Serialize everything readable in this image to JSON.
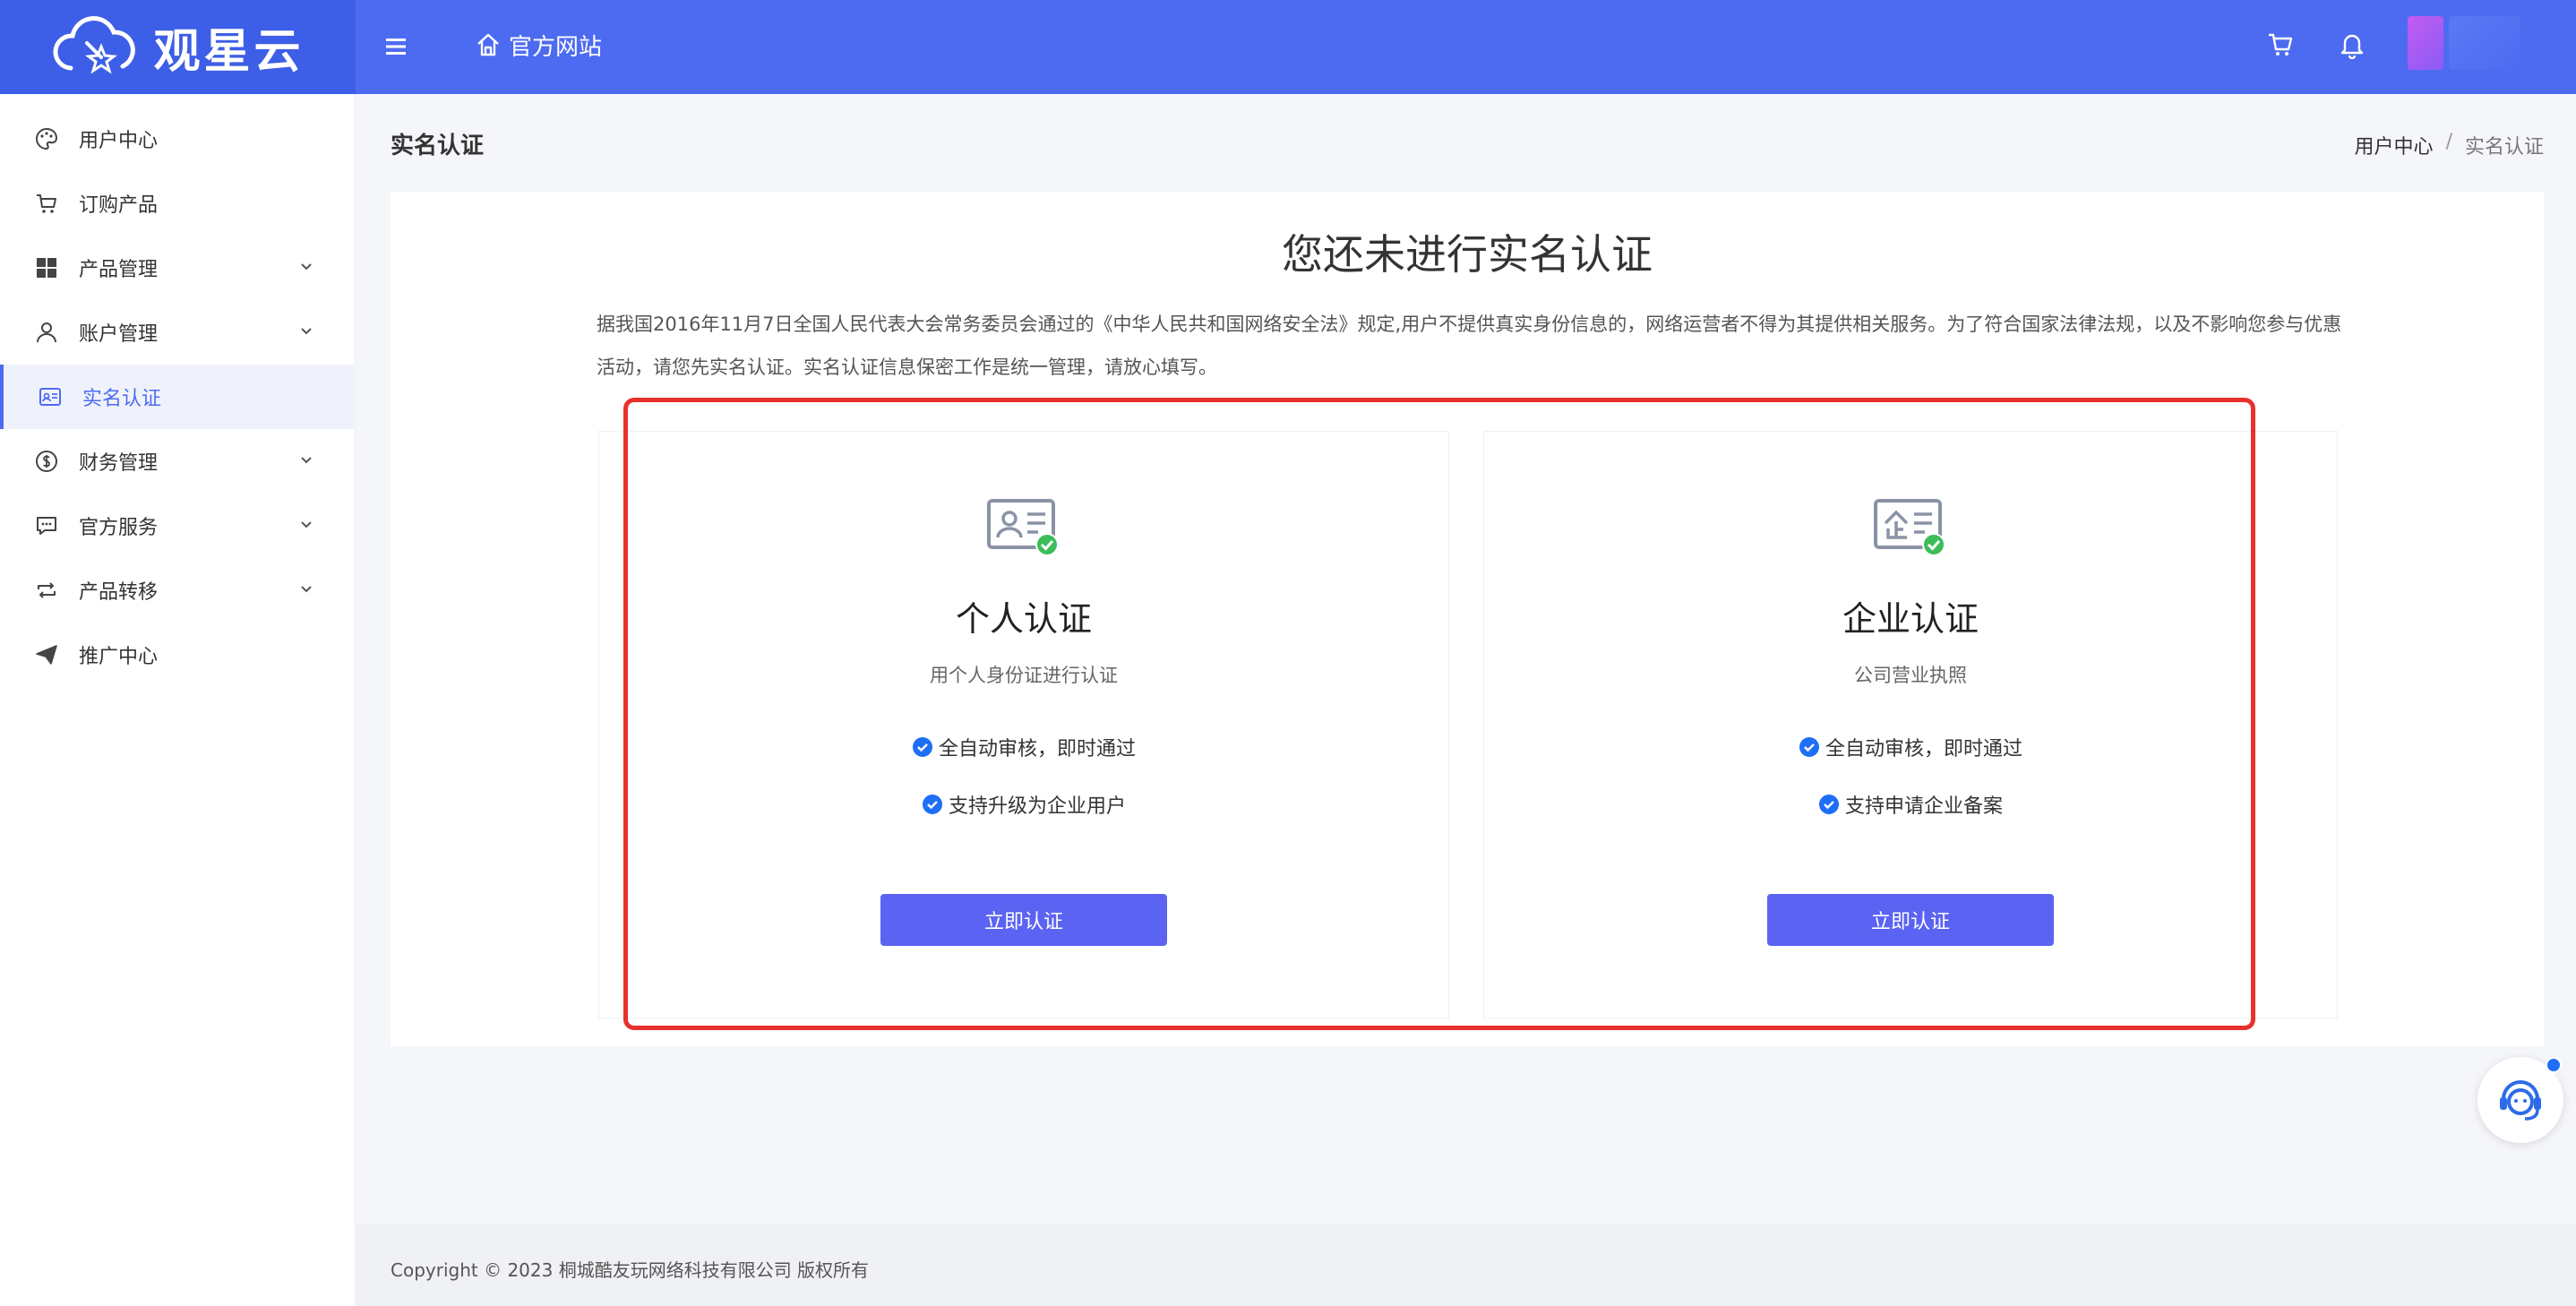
{
  "header": {
    "logo_text": "观星云",
    "home_link": "官方网站",
    "icons": [
      "menu-icon",
      "home-icon",
      "cart-icon",
      "bell-icon"
    ],
    "accent": "#4d6bf0"
  },
  "sidebar": {
    "items": [
      {
        "label": "用户中心",
        "icon": "palette-icon"
      },
      {
        "label": "订购产品",
        "icon": "cart-icon"
      },
      {
        "label": "产品管理",
        "icon": "grid-icon",
        "has_children": true
      },
      {
        "label": "账户管理",
        "icon": "user-icon",
        "has_children": true
      },
      {
        "label": "实名认证",
        "icon": "id-card-icon",
        "active": true
      },
      {
        "label": "财务管理",
        "icon": "dollar-icon",
        "has_children": true
      },
      {
        "label": "官方服务",
        "icon": "chat-icon",
        "has_children": true
      },
      {
        "label": "产品转移",
        "icon": "transfer-icon",
        "has_children": true
      },
      {
        "label": "推广中心",
        "icon": "send-icon"
      }
    ]
  },
  "page": {
    "title": "实名认证",
    "breadcrumb": [
      "用户中心",
      "实名认证"
    ],
    "heading": "您还未进行实名认证",
    "notice": "据我国2016年11月7日全国人民代表大会常务委员会通过的《中华人民共和国网络安全法》规定,用户不提供真实身份信息的，网络运营者不得为其提供相关服务。为了符合国家法律法规，以及不影响您参与优惠活动，请您先实名认证。实名认证信息保密工作是统一管理，请放心填写。"
  },
  "options": {
    "personal": {
      "title": "个人认证",
      "subtitle": "用个人身份证进行认证",
      "features": [
        "全自动审核，即时通过",
        "支持升级为企业用户"
      ],
      "button": "立即认证",
      "icon": "personal-id-card-icon"
    },
    "company": {
      "title": "企业认证",
      "subtitle": "公司营业执照",
      "features": [
        "全自动审核，即时通过",
        "支持申请企业备案"
      ],
      "button": "立即认证",
      "icon": "company-license-icon"
    }
  },
  "footer": {
    "copyright": "Copyright © 2023 桐城酷友玩网络科技有限公司 版权所有"
  },
  "colors": {
    "highlight_frame": "#e8302c",
    "button": "#5b63f2",
    "check": "#1e6ff5",
    "badge_check": "#3dbd5a"
  }
}
